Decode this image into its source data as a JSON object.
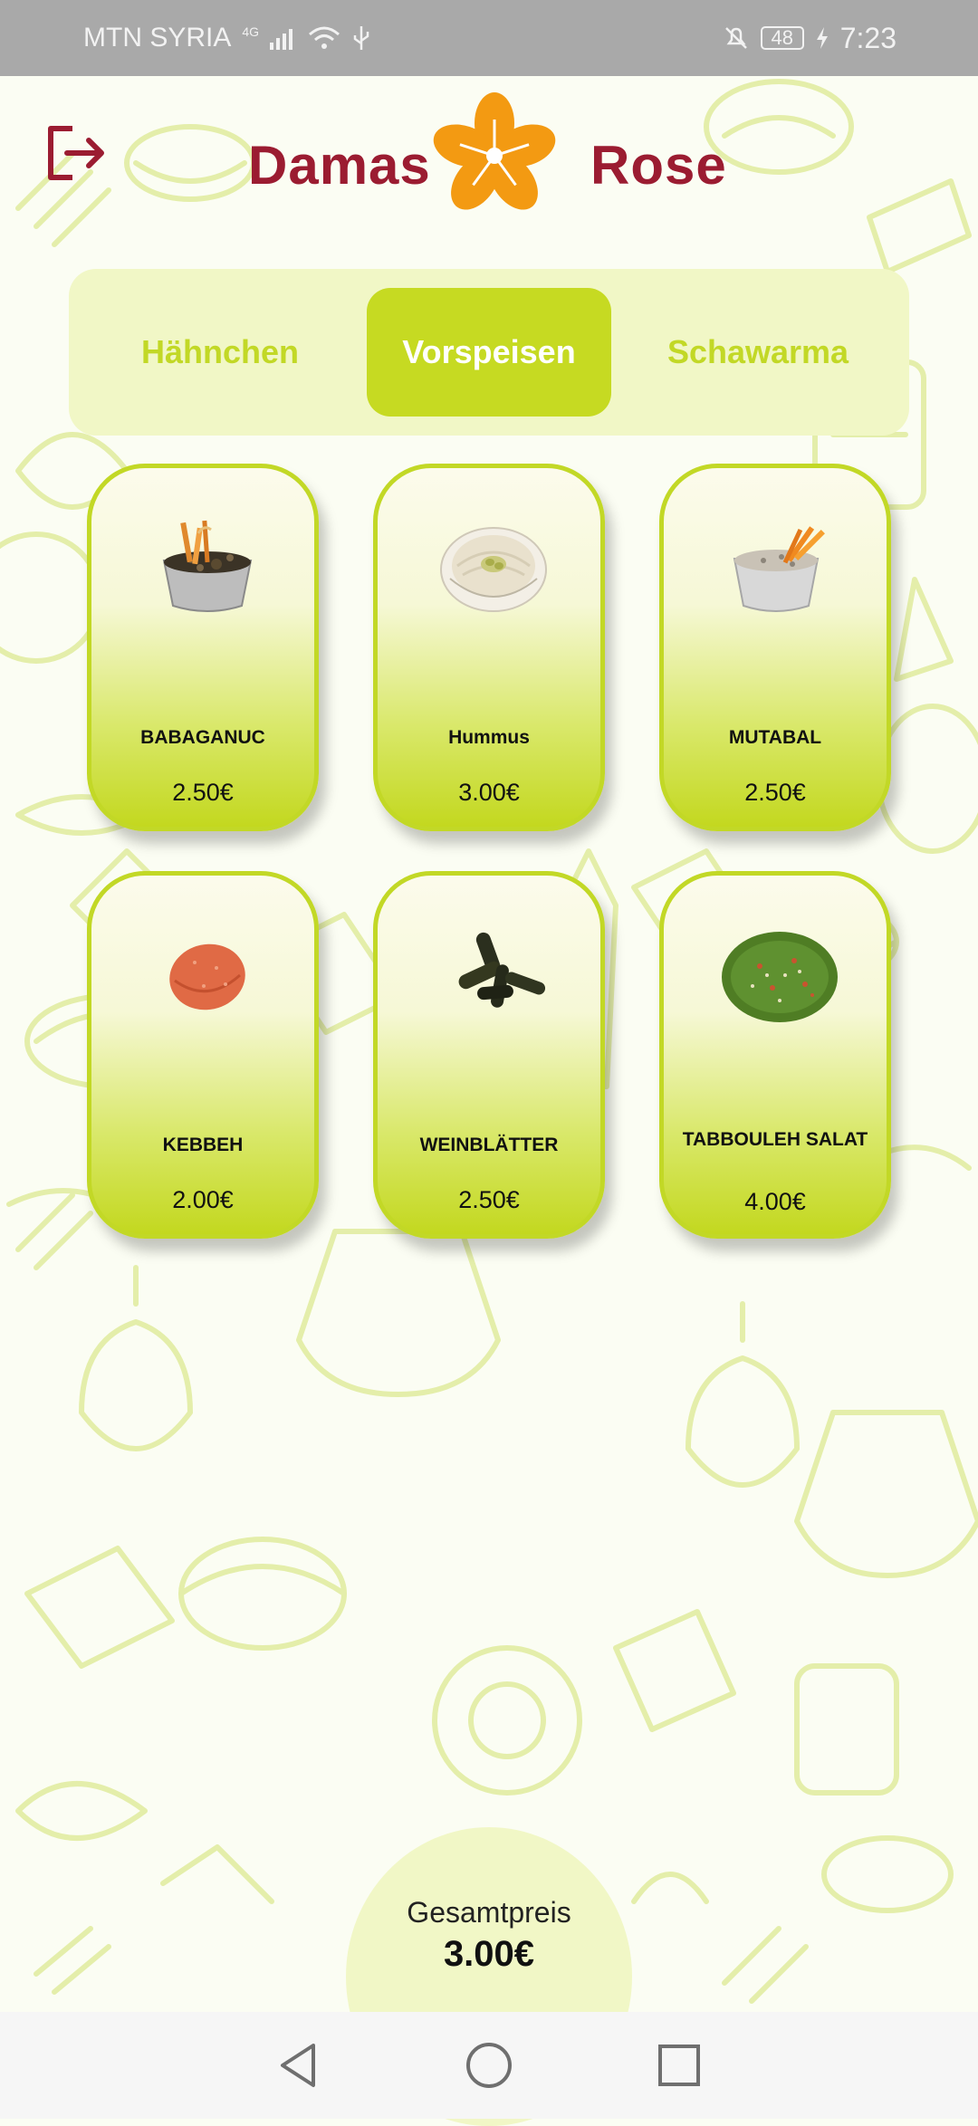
{
  "status_bar": {
    "carrier": "MTN SYRIA",
    "network": "4G",
    "battery": "48",
    "time": "7:23"
  },
  "header": {
    "logo_left": "Damas",
    "logo_right": "Rose",
    "logout_icon": "logout-icon"
  },
  "tabs": [
    {
      "label": "Hähnchen",
      "active": false
    },
    {
      "label": "Vorspeisen",
      "active": true
    },
    {
      "label": "Schawarma",
      "active": false
    }
  ],
  "products": [
    {
      "name": "BABAGANUC",
      "price": "2.50€",
      "image": "babaganuc-photo"
    },
    {
      "name": "Hummus",
      "price": "3.00€",
      "image": "hummus-photo"
    },
    {
      "name": "MUTABAL",
      "price": "2.50€",
      "image": "mutabal-photo"
    },
    {
      "name": "KEBBEH",
      "price": "2.00€",
      "image": "kebbeh-photo"
    },
    {
      "name": "WEINBLÄTTER",
      "price": "2.50€",
      "image": "weinblaetter-photo"
    },
    {
      "name": "TABBOULEH SALAT",
      "price": "4.00€",
      "image": "tabbouleh-photo"
    }
  ],
  "total": {
    "label": "Gesamtpreis",
    "value": "3.00€"
  },
  "navigation": [
    "back-icon",
    "home-icon",
    "recents-icon"
  ],
  "colors": {
    "accent": "#c6da22",
    "brand": "#9b1c31",
    "logo_flower": "#f39a12",
    "tab_background": "#f1f7c6"
  }
}
